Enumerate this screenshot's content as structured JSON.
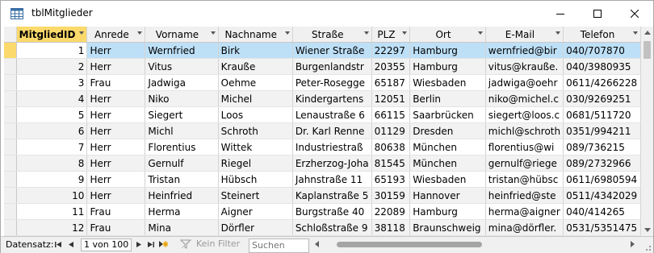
{
  "window": {
    "title": "tblMitglieder",
    "icons": {
      "app": "table-icon",
      "minimize": "minimize-icon",
      "maximize": "maximize-icon",
      "close": "close-icon"
    }
  },
  "table": {
    "columns": [
      "MitgliedID",
      "Anrede",
      "Vorname",
      "Nachname",
      "Straße",
      "PLZ",
      "Ort",
      "E-Mail",
      "Telefon"
    ],
    "rows": [
      [
        "1",
        "Herr",
        "Wernfried",
        "Birk",
        "Wiener Straße",
        "22297",
        "Hamburg",
        "wernfried@bir",
        "040/707870"
      ],
      [
        "2",
        "Herr",
        "Vitus",
        "Krauße",
        "Burgenlandstr",
        "20355",
        "Hamburg",
        "vitus@krauße.",
        "040/3980935"
      ],
      [
        "3",
        "Frau",
        "Jadwiga",
        "Oehme",
        "Peter-Rosegge",
        "65187",
        "Wiesbaden",
        "jadwiga@oehr",
        "0611/4266228"
      ],
      [
        "4",
        "Herr",
        "Niko",
        "Michel",
        "Kindergartens",
        "12051",
        "Berlin",
        "niko@michel.c",
        "030/9269251"
      ],
      [
        "5",
        "Herr",
        "Siegert",
        "Loos",
        "Lenaustraße 6",
        "66115",
        "Saarbrücken",
        "siegert@loos.c",
        "0681/511720"
      ],
      [
        "6",
        "Herr",
        "Michl",
        "Schroth",
        "Dr. Karl Renne",
        "01129",
        "Dresden",
        "michl@schroth",
        "0351/994211"
      ],
      [
        "7",
        "Herr",
        "Florentius",
        "Wittek",
        "Industriestraß",
        "80638",
        "München",
        "florentius@wi",
        "089/736215"
      ],
      [
        "8",
        "Herr",
        "Gernulf",
        "Riegel",
        "Erzherzog-Joha",
        "81545",
        "München",
        "gernulf@riege",
        "089/2732966"
      ],
      [
        "9",
        "Herr",
        "Tristan",
        "Hübsch",
        "Jahnstraße 11",
        "65193",
        "Wiesbaden",
        "tristan@hübsc",
        "0611/6980594"
      ],
      [
        "10",
        "Herr",
        "Heinfried",
        "Steinert",
        "Kaplanstraße 5",
        "30159",
        "Hannover",
        "heinfried@ste",
        "0511/4342029"
      ],
      [
        "11",
        "Frau",
        "Herma",
        "Aigner",
        "Burgstraße 40",
        "22089",
        "Hamburg",
        "herma@aigner",
        "040/414265"
      ],
      [
        "12",
        "Frau",
        "Mina",
        "Dörfler",
        "Schloßstraße 9",
        "38118",
        "Braunschweig",
        "mina@dörfler.",
        "0531/5351475"
      ]
    ],
    "current_row_index": 0,
    "colors": {
      "active_header": "#fbd96b",
      "selected_row": "#bde0f7",
      "alt_row": "#f2f2f2"
    }
  },
  "navigation": {
    "record_label": "Datensatz:",
    "record_position": "1 von 100",
    "filter_label": "Kein Filter",
    "search_placeholder": "Suchen",
    "icons": {
      "first": "first-record-icon",
      "prev": "previous-record-icon",
      "next": "next-record-icon",
      "last": "last-record-icon",
      "new": "new-record-icon",
      "filter": "filter-icon"
    }
  }
}
